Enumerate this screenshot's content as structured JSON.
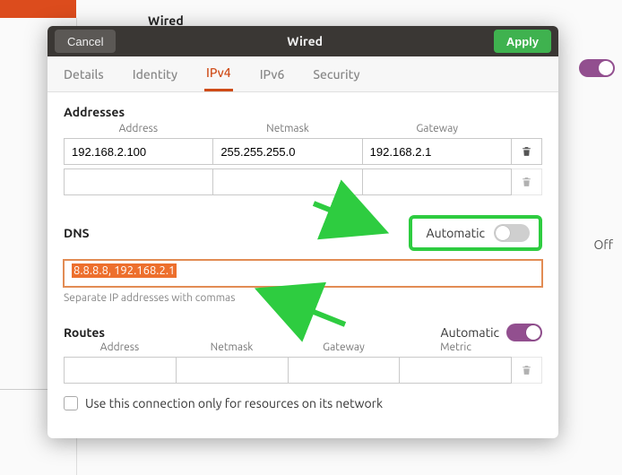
{
  "bg": {
    "wired": "Wired",
    "off": "Off"
  },
  "dialog": {
    "cancel": "Cancel",
    "title": "Wired",
    "apply": "Apply"
  },
  "tabs": {
    "details": "Details",
    "identity": "Identity",
    "ipv4": "IPv4",
    "ipv6": "IPv6",
    "security": "Security"
  },
  "addresses": {
    "title": "Addresses",
    "cols": {
      "address": "Address",
      "netmask": "Netmask",
      "gateway": "Gateway"
    },
    "rows": [
      {
        "address": "192.168.2.100",
        "netmask": "255.255.255.0",
        "gateway": "192.168.2.1"
      },
      {
        "address": "",
        "netmask": "",
        "gateway": ""
      }
    ]
  },
  "dns": {
    "title": "DNS",
    "automatic_label": "Automatic",
    "automatic_on": false,
    "value": "8.8.8.8, 192.168.2.1",
    "hint": "Separate IP addresses with commas"
  },
  "routes": {
    "title": "Routes",
    "automatic_label": "Automatic",
    "automatic_on": true,
    "cols": {
      "address": "Address",
      "netmask": "Netmask",
      "gateway": "Gateway",
      "metric": "Metric"
    },
    "rows": [
      {
        "address": "",
        "netmask": "",
        "gateway": "",
        "metric": ""
      }
    ]
  },
  "only_resources": "Use this connection only for resources on its network",
  "colors": {
    "accent": "#cf4b17",
    "apply": "#3fb24f",
    "annotation": "#2ecc40",
    "purple": "#924f8f"
  }
}
